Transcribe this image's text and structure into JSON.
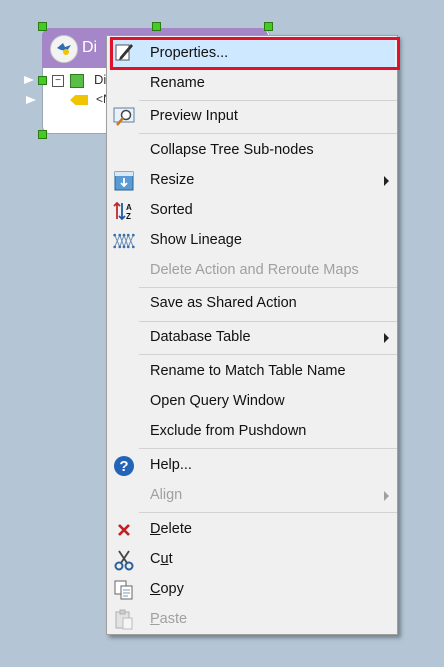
{
  "node": {
    "title": "Di",
    "tree_item_1": "Di",
    "tree_item_2": "<N"
  },
  "menu": {
    "items": [
      {
        "label": "Properties...",
        "icon": "properties-pencil-icon"
      },
      {
        "label": "Rename"
      },
      {
        "label": "Preview Input",
        "icon": "preview-magnifier-icon"
      },
      {
        "label": "Collapse Tree Sub-nodes"
      },
      {
        "label": "Resize",
        "icon": "resize-icon",
        "submenu": true
      },
      {
        "label": "Sorted",
        "icon": "sort-az-icon"
      },
      {
        "label": "Show Lineage",
        "icon": "lineage-icon"
      },
      {
        "label": "Delete Action and Reroute Maps",
        "disabled": true
      },
      {
        "label": "Save as Shared Action"
      },
      {
        "label": "Database Table",
        "submenu": true
      },
      {
        "label": "Rename to Match Table Name"
      },
      {
        "label": "Open Query Window"
      },
      {
        "label": "Exclude from Pushdown"
      },
      {
        "label": "Help...",
        "icon": "help-icon"
      },
      {
        "label": "Align",
        "disabled": true,
        "submenu": true
      },
      {
        "label": "Delete",
        "icon": "delete-x-icon",
        "accelerator": "D"
      },
      {
        "label": "Cut",
        "icon": "scissors-icon",
        "accelerator": "u"
      },
      {
        "label": "Copy",
        "icon": "copy-icon",
        "accelerator": "C"
      },
      {
        "label": "Paste",
        "icon": "paste-icon",
        "accelerator": "P",
        "disabled": true
      }
    ]
  },
  "colors": {
    "highlight": "#cde8ff",
    "focus_ring": "#e0112b",
    "node_header": "#a586c8",
    "background": "#b4c6d6"
  }
}
